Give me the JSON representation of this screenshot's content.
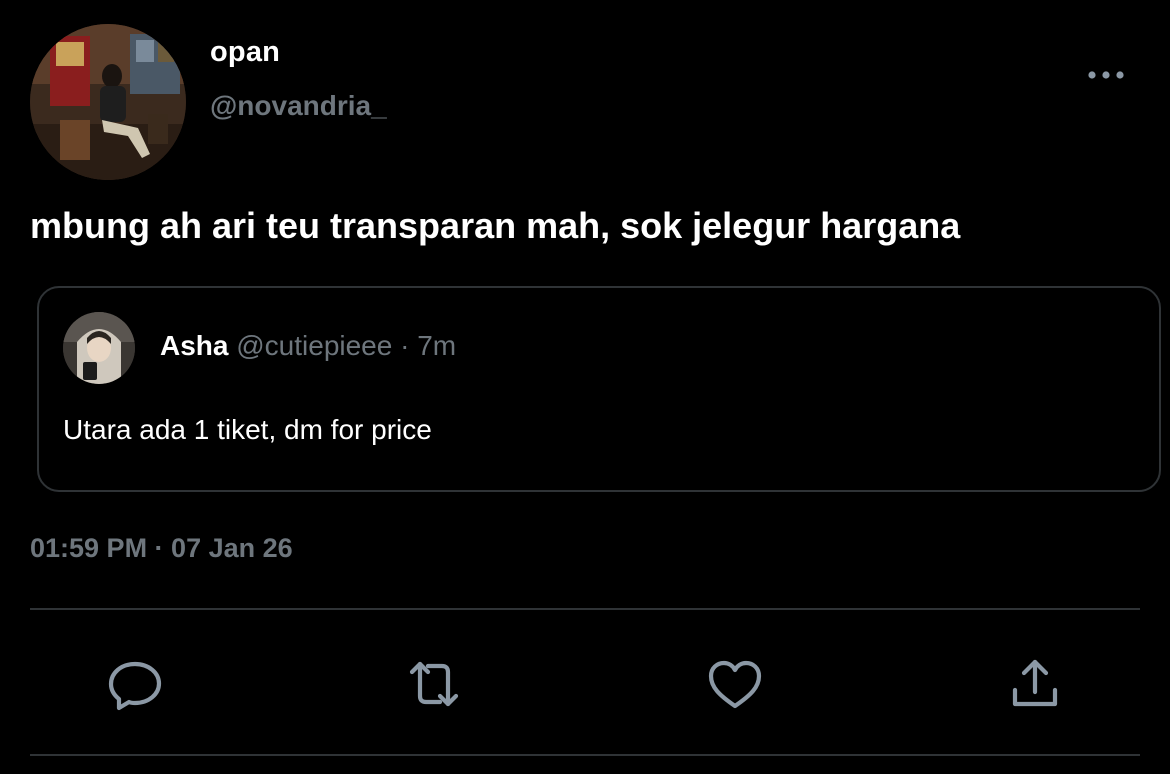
{
  "author": {
    "display_name": "opan",
    "handle": "@novandria_"
  },
  "tweet": {
    "text": "mbung ah ari teu transparan mah, sok jelegur hargana",
    "timestamp": "01:59 PM · 07 Jan 26"
  },
  "quoted_tweet": {
    "display_name": "Asha",
    "handle": "@cutiepieee",
    "separator": " · ",
    "age": "7m",
    "text": "Utara ada 1 tiket, dm for price"
  },
  "actions": {
    "reply_icon": "reply-icon",
    "retweet_icon": "retweet-icon",
    "like_icon": "heart-icon",
    "share_icon": "share-icon",
    "more_icon": "more-horizontal-icon"
  },
  "colors": {
    "background": "#000000",
    "primary_text": "#ffffff",
    "secondary_text": "#6e767d",
    "border": "#2f3336",
    "icon": "#8b98a5"
  }
}
